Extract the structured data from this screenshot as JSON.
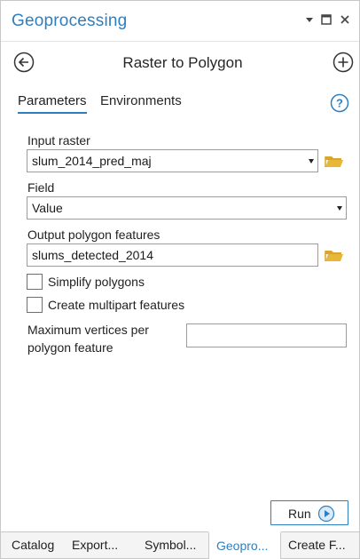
{
  "pane": {
    "title": "Geoprocessing"
  },
  "tool": {
    "title": "Raster to Polygon"
  },
  "tabs": {
    "parameters": "Parameters",
    "environments": "Environments"
  },
  "form": {
    "input_raster": {
      "label": "Input raster",
      "value": "slum_2014_pred_maj"
    },
    "field": {
      "label": "Field",
      "value": "Value"
    },
    "output": {
      "label": "Output polygon features",
      "value": "slums_detected_2014"
    },
    "simplify": {
      "label": "Simplify polygons",
      "checked": false
    },
    "multipart": {
      "label": "Create multipart features",
      "checked": false
    },
    "max_vertices": {
      "label": "Maximum vertices per polygon feature",
      "value": ""
    }
  },
  "run_button": {
    "label": "Run"
  },
  "bottom_tabs": [
    {
      "label": "Catalog",
      "active": false
    },
    {
      "label": "Export...",
      "active": false
    },
    {
      "label": "Symbol...",
      "active": false
    },
    {
      "label": "Geopro...",
      "active": true
    },
    {
      "label": "Create F...",
      "active": false
    }
  ],
  "colors": {
    "accent": "#2d7fc0",
    "folder": "#e8b73a"
  },
  "icons": {
    "back": "back-arrow-icon",
    "add": "add-icon",
    "help": "help-icon",
    "browse": "folder-icon",
    "run": "play-icon"
  }
}
